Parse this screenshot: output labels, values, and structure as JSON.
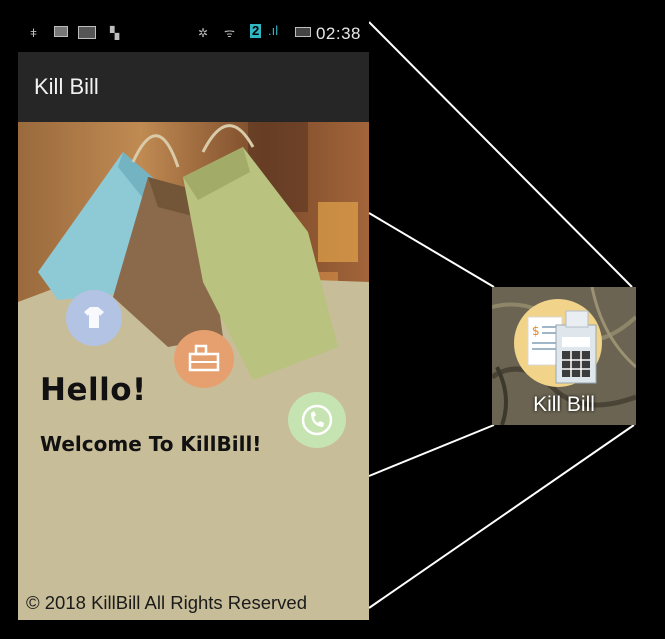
{
  "status_bar": {
    "time": "02:38",
    "network_badge": "2",
    "icons": [
      "usb-icon",
      "message-icon",
      "image-icon",
      "notification-icon",
      "sync-icon",
      "wifi-icon",
      "signal-icon",
      "battery-icon"
    ]
  },
  "app_bar": {
    "title": "Kill Bill"
  },
  "main": {
    "greeting": "Hello!",
    "welcome": "Welcome To KillBill!",
    "feature_icons": [
      "tshirt-icon",
      "shop-counter-icon",
      "phone-icon"
    ]
  },
  "footer": {
    "text": "© 2018 KillBill All Rights Reserved"
  },
  "launcher": {
    "label": "Kill Bill",
    "icon": "receipt-calculator-icon"
  },
  "colors": {
    "app_bar": "#262626",
    "content_bg": "#c8bd99",
    "bag_blue": "#8ec9d6",
    "bag_brown": "#8a6a4b",
    "bag_green": "#b9c27f"
  }
}
